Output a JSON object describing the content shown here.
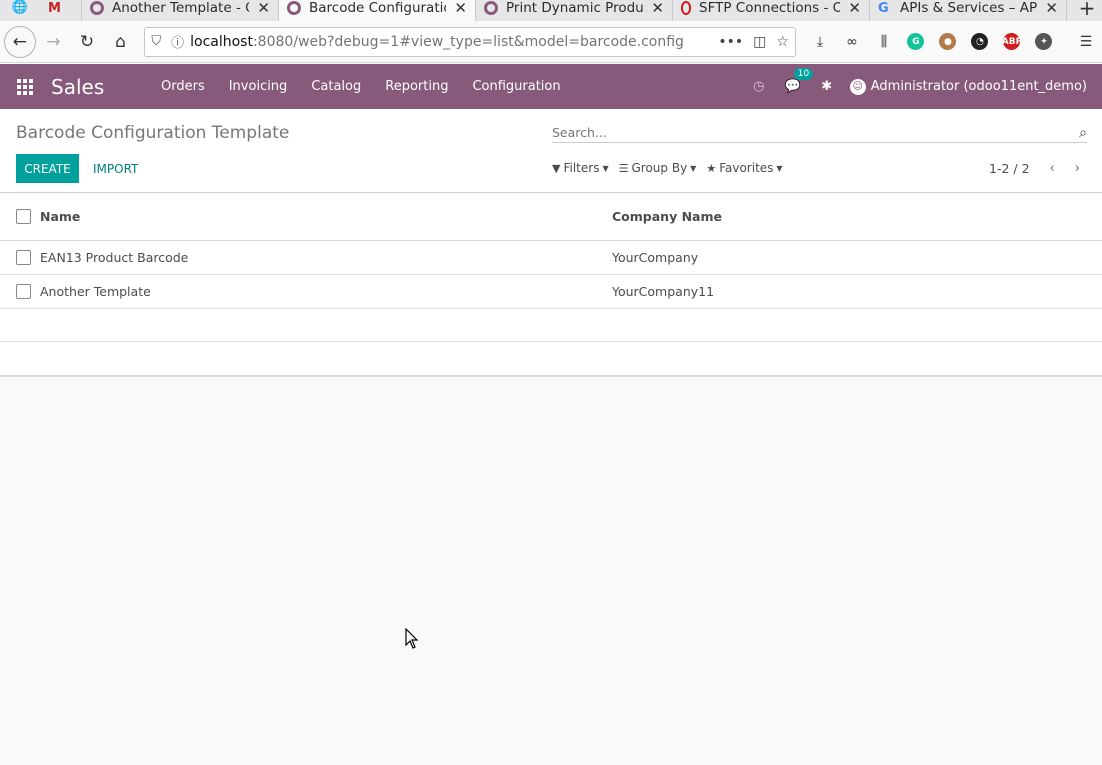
{
  "browser": {
    "tabs": [
      {
        "title": "",
        "icon": "gmail-icon",
        "active": false
      },
      {
        "title": "Another Template - O",
        "icon": "odoo-icon",
        "active": false
      },
      {
        "title": "Barcode Configuratio",
        "icon": "odoo-icon",
        "active": true
      },
      {
        "title": "Print Dynamic Produ",
        "icon": "odoo-icon",
        "active": false
      },
      {
        "title": "SFTP Connections - O",
        "icon": "opera-icon",
        "active": false
      },
      {
        "title": "APIs & Services – AP",
        "icon": "google-icon",
        "active": false
      }
    ],
    "url_host": "localhost",
    "url_rest": ":8080/web?debug=1#view_type=list&model=barcode.config"
  },
  "odoo": {
    "app_name": "Sales",
    "menu": [
      "Orders",
      "Invoicing",
      "Catalog",
      "Reporting",
      "Configuration"
    ],
    "notification_count": "10",
    "user": "Administrator (odoo11ent_demo)"
  },
  "control_panel": {
    "breadcrumb": "Barcode Configuration Template",
    "search_placeholder": "Search...",
    "create_label": "CREATE",
    "import_label": "IMPORT",
    "filters_label": "Filters",
    "groupby_label": "Group By",
    "favorites_label": "Favorites",
    "pager": "1-2 / 2"
  },
  "list": {
    "columns": [
      "Name",
      "Company Name"
    ],
    "rows": [
      {
        "name": "EAN13 Product Barcode",
        "company": "YourCompany"
      },
      {
        "name": "Another Template",
        "company": "YourCompany11"
      }
    ]
  },
  "colors": {
    "odoo_purple": "#875a7b",
    "odoo_teal": "#00a09d"
  }
}
